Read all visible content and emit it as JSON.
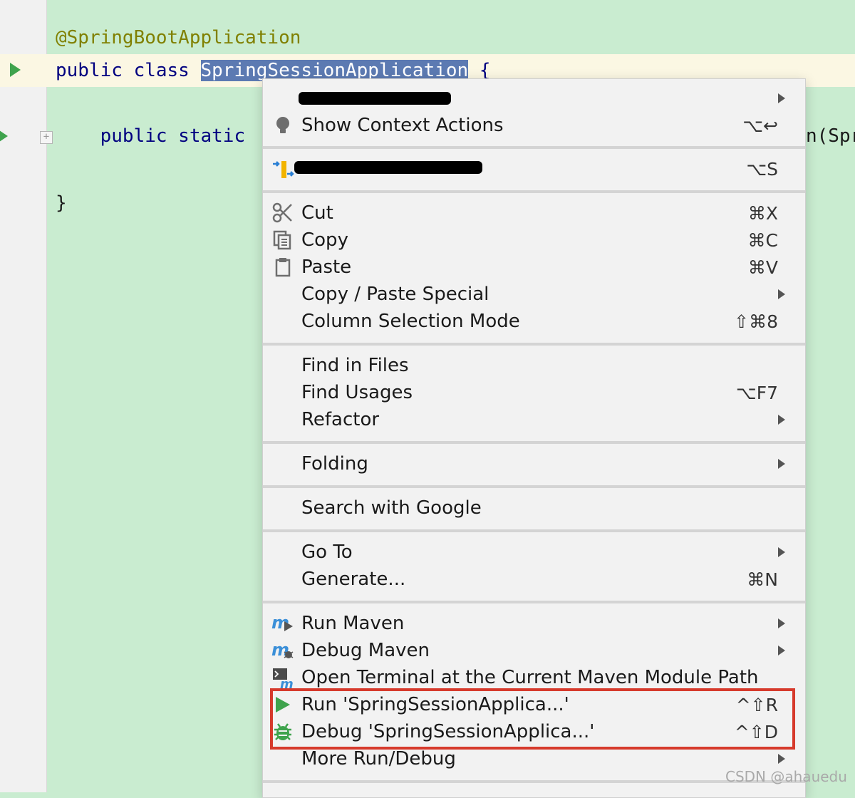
{
  "editor": {
    "line1": "@SpringBootApplication",
    "line2_kw": "public class ",
    "line2_selected": "SpringSessionApplication",
    "line2_rest": " {",
    "line3": "    public static ",
    "line3_tail": "n(Spr",
    "line4": "}"
  },
  "menu": {
    "sections": [
      {
        "items": [
          {
            "label": "",
            "shortcut": "",
            "has_submenu": true,
            "redacted": true
          },
          {
            "label": "Show Context Actions",
            "shortcut": "⌥↩",
            "icon": "lightbulb-icon"
          }
        ]
      },
      {
        "items": [
          {
            "label": "",
            "shortcut": "⌥S",
            "icon": "sequence-diagram-icon",
            "redacted": true
          }
        ]
      },
      {
        "items": [
          {
            "label": "Cut",
            "shortcut": "⌘X",
            "icon": "scissors-icon"
          },
          {
            "label": "Copy",
            "shortcut": "⌘C",
            "icon": "copy-icon"
          },
          {
            "label": "Paste",
            "shortcut": "⌘V",
            "icon": "clipboard-icon"
          },
          {
            "label": "Copy / Paste Special",
            "has_submenu": true
          },
          {
            "label": "Column Selection Mode",
            "shortcut": "⇧⌘8"
          }
        ]
      },
      {
        "items": [
          {
            "label": "Find in Files"
          },
          {
            "label": "Find Usages",
            "shortcut": "⌥F7"
          },
          {
            "label": "Refactor",
            "has_submenu": true
          }
        ]
      },
      {
        "items": [
          {
            "label": "Folding",
            "has_submenu": true
          }
        ]
      },
      {
        "items": [
          {
            "label": "Search with Google"
          }
        ]
      },
      {
        "items": [
          {
            "label": "Go To",
            "has_submenu": true
          },
          {
            "label": "Generate...",
            "shortcut": "⌘N"
          }
        ]
      },
      {
        "items": [
          {
            "label": "Run Maven",
            "has_submenu": true,
            "icon": "maven-run-icon"
          },
          {
            "label": "Debug Maven",
            "has_submenu": true,
            "icon": "maven-debug-icon"
          },
          {
            "label": "Open Terminal at the Current Maven Module Path",
            "icon": "maven-terminal-icon"
          },
          {
            "label": "Run 'SpringSessionApplica...'",
            "shortcut": "^⇧R",
            "icon": "run-icon"
          },
          {
            "label": "Debug 'SpringSessionApplica...'",
            "shortcut": "^⇧D",
            "icon": "debug-icon"
          },
          {
            "label": "More Run/Debug",
            "has_submenu": true
          }
        ]
      }
    ]
  },
  "watermark": "CSDN @ahauedu",
  "colors": {
    "editor_bg": "#c9ecd0",
    "selection": "#5c7ab2",
    "annotation": "#808000",
    "keyword": "#000080",
    "run_green": "#3fa34d",
    "highlight_red": "#d63a2c"
  }
}
